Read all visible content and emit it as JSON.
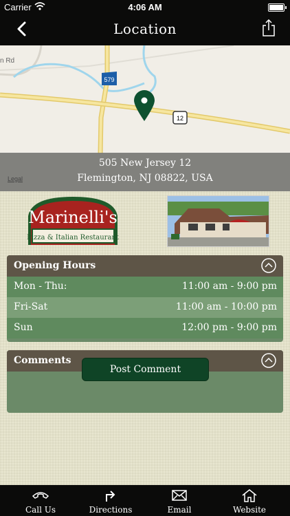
{
  "status_bar": {
    "carrier": "Carrier",
    "time": "4:06 AM"
  },
  "nav": {
    "title": "Location",
    "back_icon": "chevron-left-icon",
    "share_icon": "share-icon"
  },
  "map": {
    "road_label": "n Rd",
    "route_579": "579",
    "route_12": "12",
    "address_line1": "505 New Jersey 12",
    "address_line2": "Flemington, NJ 08822, USA",
    "legal": "Legal"
  },
  "logo": {
    "name": "Marinelli's",
    "tagline": "Pizza & Italian Restaurant"
  },
  "opening_hours": {
    "title": "Opening Hours",
    "rows": [
      {
        "day": "Mon - Thu:",
        "hours": "11:00 am - 9:00 pm"
      },
      {
        "day": "Fri-Sat",
        "hours": "11:00 am - 10:00 pm"
      },
      {
        "day": "Sun",
        "hours": "12:00 pm - 9:00 pm"
      }
    ]
  },
  "comments": {
    "title": "Comments",
    "post_label": "Post Comment"
  },
  "tabbar": {
    "items": [
      {
        "label": "Call Us",
        "icon": "phone-icon"
      },
      {
        "label": "Directions",
        "icon": "directions-icon"
      },
      {
        "label": "Email",
        "icon": "envelope-icon"
      },
      {
        "label": "Website",
        "icon": "home-icon"
      }
    ]
  }
}
